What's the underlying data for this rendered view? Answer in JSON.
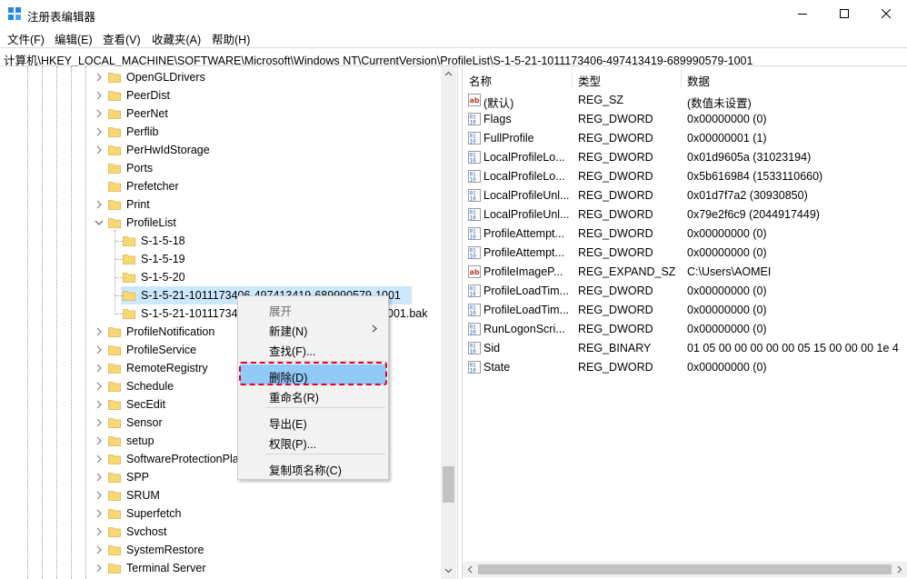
{
  "window": {
    "title": "注册表编辑器",
    "minimize_icon": "minimize-icon",
    "maximize_icon": "maximize-icon",
    "close_icon": "close-icon"
  },
  "menu": [
    "文件(F)",
    "编辑(E)",
    "查看(V)",
    "收藏夹(A)",
    "帮助(H)"
  ],
  "address": "计算机\\HKEY_LOCAL_MACHINE\\SOFTWARE\\Microsoft\\Windows NT\\CurrentVersion\\ProfileList\\S-1-5-21-1011173406-497413419-689990579-1001",
  "tree": {
    "items_top": [
      "OpenGLDrivers",
      "PeerDist",
      "PeerNet",
      "Perflib",
      "PerHwIdStorage",
      "Ports",
      "Prefetcher",
      "Print",
      "ProfileList"
    ],
    "profile_children": [
      "S-1-5-18",
      "S-1-5-19",
      "S-1-5-20",
      "S-1-5-21-1011173406-497413419-689990579-1001",
      "S-1-5-21-10111734"
    ],
    "profile_children_tail": "001.bak",
    "items_bottom": [
      "ProfileNotification",
      "ProfileService",
      "RemoteRegistry",
      "Schedule",
      "SecEdit",
      "Sensor",
      "setup",
      "SoftwareProtectionPla",
      "SPP",
      "SRUM",
      "Superfetch",
      "Svchost",
      "SystemRestore",
      "Terminal Server"
    ]
  },
  "list": {
    "headers": {
      "name": "名称",
      "type": "类型",
      "data": "数据"
    },
    "rows": [
      {
        "icon": "string-value-icon",
        "name": "(默认)",
        "type": "REG_SZ",
        "data": "(数值未设置)"
      },
      {
        "icon": "binary-value-icon",
        "name": "Flags",
        "type": "REG_DWORD",
        "data": "0x00000000 (0)"
      },
      {
        "icon": "binary-value-icon",
        "name": "FullProfile",
        "type": "REG_DWORD",
        "data": "0x00000001 (1)"
      },
      {
        "icon": "binary-value-icon",
        "name": "LocalProfileLo...",
        "type": "REG_DWORD",
        "data": "0x01d9605a (31023194)"
      },
      {
        "icon": "binary-value-icon",
        "name": "LocalProfileLo...",
        "type": "REG_DWORD",
        "data": "0x5b616984 (1533110660)"
      },
      {
        "icon": "binary-value-icon",
        "name": "LocalProfileUnl...",
        "type": "REG_DWORD",
        "data": "0x01d7f7a2 (30930850)"
      },
      {
        "icon": "binary-value-icon",
        "name": "LocalProfileUnl...",
        "type": "REG_DWORD",
        "data": "0x79e2f6c9 (2044917449)"
      },
      {
        "icon": "binary-value-icon",
        "name": "ProfileAttempt...",
        "type": "REG_DWORD",
        "data": "0x00000000 (0)"
      },
      {
        "icon": "binary-value-icon",
        "name": "ProfileAttempt...",
        "type": "REG_DWORD",
        "data": "0x00000000 (0)"
      },
      {
        "icon": "string-value-icon",
        "name": "ProfileImageP...",
        "type": "REG_EXPAND_SZ",
        "data": "C:\\Users\\AOMEI"
      },
      {
        "icon": "binary-value-icon",
        "name": "ProfileLoadTim...",
        "type": "REG_DWORD",
        "data": "0x00000000 (0)"
      },
      {
        "icon": "binary-value-icon",
        "name": "ProfileLoadTim...",
        "type": "REG_DWORD",
        "data": "0x00000000 (0)"
      },
      {
        "icon": "binary-value-icon",
        "name": "RunLogonScri...",
        "type": "REG_DWORD",
        "data": "0x00000000 (0)"
      },
      {
        "icon": "binary-value-icon",
        "name": "Sid",
        "type": "REG_BINARY",
        "data": "01 05 00 00 00 00 00 05 15 00 00 00 1e 4"
      },
      {
        "icon": "binary-value-icon",
        "name": "State",
        "type": "REG_DWORD",
        "data": "0x00000000 (0)"
      }
    ]
  },
  "context_menu": {
    "expand": "展开",
    "new": "新建(N)",
    "find": "查找(F)...",
    "delete": "删除(D)",
    "rename": "重命名(R)",
    "export": "导出(E)",
    "permissions": "权限(P)...",
    "copy_key_name": "复制项名称(C)"
  },
  "colors": {
    "selection": "#cce8ff",
    "menu_highlight": "#91c9f7",
    "annotation": "#e0002a",
    "folder": "#f8d775"
  }
}
